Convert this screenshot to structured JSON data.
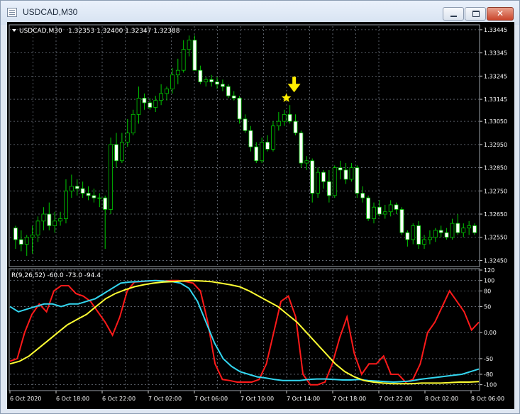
{
  "window": {
    "title": "USDCAD,M30",
    "buttons": {
      "minimize": "minimize-icon",
      "maximize": "maximize-icon",
      "close": "✕"
    }
  },
  "chart_info": {
    "symbol_label": "USDCAD,M30",
    "ohlc": "1.32353 1.32400 1.32347 1.32388",
    "indicator_label": "R(9,26,52) -60.0 -73.0 -94.4"
  },
  "colors": {
    "background": "#000000",
    "grid": "#6e7580",
    "candle_line": "#00c800",
    "candle_bull_body": "#000000",
    "candle_bear_body": "#ffffff",
    "red": "#ff1a1a",
    "cyan": "#33d6f0",
    "yellow": "#ffff33",
    "marker": "#ffee00"
  },
  "price_scale": [
    "1.33445",
    "1.33345",
    "1.33245",
    "1.33145",
    "1.33050",
    "1.32950",
    "1.32850",
    "1.32750",
    "1.32650",
    "1.32550",
    "1.32450"
  ],
  "indicator_scale": [
    "120",
    "100",
    "80",
    "50",
    "0.00",
    "-50",
    "-80",
    "-100"
  ],
  "time_labels": [
    "6 Oct 2020",
    "6 Oct 18:00",
    "6 Oct 22:00",
    "7 Oct 02:00",
    "7 Oct 06:00",
    "7 Oct 10:00",
    "7 Oct 14:00",
    "7 Oct 18:00",
    "7 Oct 22:00",
    "8 Oct 02:00",
    "8 Oct 06:00"
  ],
  "chart_data": [
    {
      "type": "candlestick",
      "title": "USDCAD,M30",
      "ylim": [
        1.3243,
        1.3346
      ],
      "marker": {
        "candle_index": 49,
        "icons": [
          "star-icon",
          "arrow-down-icon"
        ]
      },
      "candles": [
        [
          1.3259,
          1.326,
          1.325,
          1.3254
        ],
        [
          1.3254,
          1.3258,
          1.3249,
          1.3252
        ],
        [
          1.3252,
          1.3256,
          1.3247,
          1.3255
        ],
        [
          1.3255,
          1.326,
          1.3248,
          1.3256
        ],
        [
          1.3256,
          1.3264,
          1.3253,
          1.3262
        ],
        [
          1.3262,
          1.3268,
          1.3258,
          1.3265
        ],
        [
          1.3265,
          1.327,
          1.3258,
          1.326
        ],
        [
          1.326,
          1.3266,
          1.3257,
          1.3262
        ],
        [
          1.3262,
          1.3266,
          1.326,
          1.3263
        ],
        [
          1.3263,
          1.328,
          1.3261,
          1.3275
        ],
        [
          1.3275,
          1.3282,
          1.3272,
          1.3277
        ],
        [
          1.3277,
          1.328,
          1.3273,
          1.3276
        ],
        [
          1.3276,
          1.3279,
          1.3272,
          1.3274
        ],
        [
          1.3274,
          1.3277,
          1.3271,
          1.3273
        ],
        [
          1.3273,
          1.3276,
          1.327,
          1.3272
        ],
        [
          1.3272,
          1.3274,
          1.3268,
          1.3272
        ],
        [
          1.3272,
          1.3273,
          1.325,
          1.3267
        ],
        [
          1.3267,
          1.3298,
          1.3265,
          1.3295
        ],
        [
          1.3295,
          1.33,
          1.3285,
          1.3288
        ],
        [
          1.3288,
          1.33,
          1.3287,
          1.3296
        ],
        [
          1.3296,
          1.3306,
          1.3294,
          1.33
        ],
        [
          1.33,
          1.331,
          1.3299,
          1.3308
        ],
        [
          1.3308,
          1.332,
          1.3304,
          1.3315
        ],
        [
          1.3315,
          1.3317,
          1.331,
          1.3313
        ],
        [
          1.3313,
          1.3315,
          1.331,
          1.3311
        ],
        [
          1.3311,
          1.3316,
          1.3309,
          1.3314
        ],
        [
          1.3314,
          1.3321,
          1.3312,
          1.3317
        ],
        [
          1.3317,
          1.332,
          1.3314,
          1.3319
        ],
        [
          1.3319,
          1.3328,
          1.3317,
          1.3325
        ],
        [
          1.3325,
          1.3332,
          1.3321,
          1.3327
        ],
        [
          1.3327,
          1.334,
          1.3326,
          1.3336
        ],
        [
          1.3336,
          1.3342,
          1.3333,
          1.334
        ],
        [
          1.334,
          1.3342,
          1.333,
          1.3327
        ],
        [
          1.3327,
          1.3329,
          1.3321,
          1.3322
        ],
        [
          1.3322,
          1.3324,
          1.332,
          1.3323
        ],
        [
          1.3323,
          1.3325,
          1.332,
          1.3322
        ],
        [
          1.3322,
          1.3324,
          1.3319,
          1.3321
        ],
        [
          1.3321,
          1.3323,
          1.3318,
          1.332
        ],
        [
          1.332,
          1.3321,
          1.3315,
          1.3316
        ],
        [
          1.3316,
          1.3318,
          1.3314,
          1.3315
        ],
        [
          1.3315,
          1.3316,
          1.3304,
          1.3306
        ],
        [
          1.3306,
          1.3308,
          1.33,
          1.3301
        ],
        [
          1.3301,
          1.3303,
          1.3292,
          1.3294
        ],
        [
          1.3294,
          1.3296,
          1.3287,
          1.3288
        ],
        [
          1.3288,
          1.3298,
          1.3287,
          1.3296
        ],
        [
          1.3296,
          1.3299,
          1.3292,
          1.3293
        ],
        [
          1.3293,
          1.3305,
          1.3292,
          1.3303
        ],
        [
          1.3303,
          1.3309,
          1.3301,
          1.3305
        ],
        [
          1.3305,
          1.331,
          1.3303,
          1.3308
        ],
        [
          1.3308,
          1.3312,
          1.3304,
          1.3305
        ],
        [
          1.3305,
          1.3308,
          1.3299,
          1.33
        ],
        [
          1.33,
          1.3301,
          1.3285,
          1.3287
        ],
        [
          1.3287,
          1.329,
          1.3284,
          1.3288
        ],
        [
          1.3288,
          1.3289,
          1.327,
          1.3274
        ],
        [
          1.3274,
          1.3285,
          1.3272,
          1.3283
        ],
        [
          1.3283,
          1.3284,
          1.3276,
          1.3279
        ],
        [
          1.3279,
          1.3284,
          1.327,
          1.3273
        ],
        [
          1.3273,
          1.3286,
          1.3272,
          1.3285
        ],
        [
          1.3285,
          1.3288,
          1.328,
          1.3284
        ],
        [
          1.3284,
          1.3287,
          1.3278,
          1.328
        ],
        [
          1.328,
          1.3287,
          1.3279,
          1.3285
        ],
        [
          1.3285,
          1.3286,
          1.3272,
          1.3274
        ],
        [
          1.3274,
          1.3277,
          1.327,
          1.3272
        ],
        [
          1.3272,
          1.3273,
          1.3262,
          1.3263
        ],
        [
          1.3263,
          1.327,
          1.3261,
          1.3268
        ],
        [
          1.3268,
          1.3271,
          1.3264,
          1.3265
        ],
        [
          1.3265,
          1.3269,
          1.3263,
          1.3266
        ],
        [
          1.3266,
          1.3271,
          1.3264,
          1.3269
        ],
        [
          1.3269,
          1.327,
          1.3265,
          1.3267
        ],
        [
          1.3267,
          1.3268,
          1.3256,
          1.3257
        ],
        [
          1.3257,
          1.3258,
          1.3251,
          1.3254
        ],
        [
          1.3254,
          1.3261,
          1.3252,
          1.326
        ],
        [
          1.326,
          1.3262,
          1.325,
          1.3252
        ],
        [
          1.3252,
          1.3256,
          1.325,
          1.3254
        ],
        [
          1.3254,
          1.3258,
          1.3252,
          1.3255
        ],
        [
          1.3255,
          1.3259,
          1.3253,
          1.3258
        ],
        [
          1.3258,
          1.326,
          1.3255,
          1.3257
        ],
        [
          1.3257,
          1.3259,
          1.3254,
          1.3255
        ],
        [
          1.3255,
          1.3263,
          1.3254,
          1.3261
        ],
        [
          1.3261,
          1.3265,
          1.3256,
          1.3257
        ],
        [
          1.3257,
          1.3261,
          1.3255,
          1.3259
        ],
        [
          1.3259,
          1.3262,
          1.3256,
          1.326
        ],
        [
          1.326,
          1.3261,
          1.3256,
          1.3257
        ]
      ]
    },
    {
      "type": "line",
      "title": "R(9,26,52) -60.0 -73.0 -94.4",
      "ylim": [
        -110,
        120
      ],
      "series": [
        {
          "color": "#ff1a1a",
          "values": [
            -55,
            -50,
            0,
            35,
            55,
            40,
            80,
            90,
            90,
            75,
            70,
            60,
            40,
            20,
            -5,
            30,
            80,
            97,
            98,
            99,
            100,
            99,
            100,
            100,
            98,
            95,
            80,
            20,
            -60,
            -90,
            -92,
            -95,
            -95,
            -95,
            -90,
            -60,
            0,
            60,
            70,
            30,
            -80,
            -100,
            -100,
            -95,
            -60,
            -10,
            30,
            -40,
            -80,
            -60,
            -60,
            -45,
            -80,
            -80,
            -95,
            -90,
            -60,
            0,
            20,
            50,
            80,
            60,
            40,
            5,
            20
          ]
        },
        {
          "color": "#33d6f0",
          "values": [
            50,
            40,
            45,
            50,
            55,
            55,
            50,
            55,
            55,
            60,
            65,
            75,
            85,
            95,
            97,
            98,
            99,
            100,
            99,
            98,
            95,
            85,
            60,
            20,
            -20,
            -50,
            -65,
            -75,
            -80,
            -85,
            -87,
            -90,
            -92,
            -92,
            -92,
            -90,
            -89,
            -89,
            -90,
            -91,
            -91,
            -90,
            -92,
            -93,
            -94,
            -95,
            -94,
            -93,
            -90,
            -88,
            -86,
            -84,
            -82,
            -80,
            -75,
            -70
          ]
        },
        {
          "color": "#ffff33",
          "values": [
            -60,
            -55,
            -45,
            -30,
            -15,
            0,
            15,
            25,
            35,
            50,
            65,
            75,
            82,
            88,
            92,
            95,
            97,
            98,
            99,
            100,
            99,
            98,
            95,
            92,
            88,
            80,
            70,
            60,
            50,
            35,
            20,
            0,
            -20,
            -40,
            -60,
            -75,
            -85,
            -92,
            -95,
            -97,
            -98,
            -98,
            -98,
            -97,
            -97,
            -97,
            -96,
            -95,
            -95,
            -94
          ]
        }
      ]
    }
  ]
}
